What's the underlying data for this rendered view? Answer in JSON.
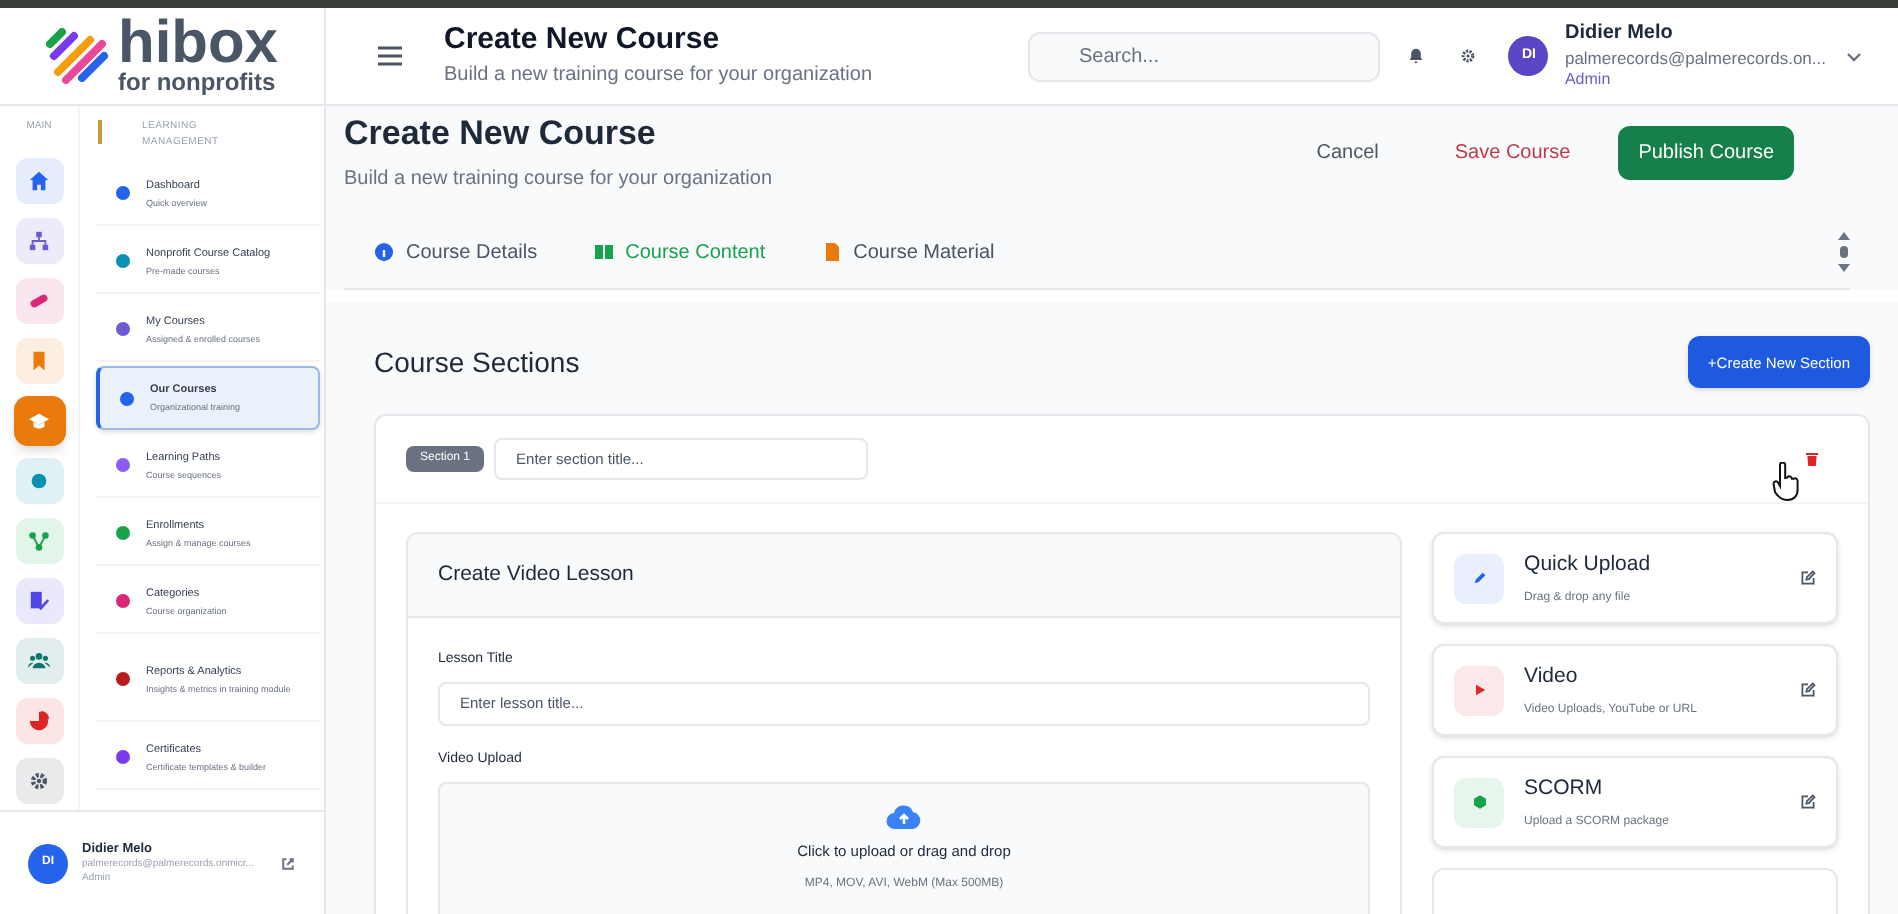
{
  "logo": {
    "name": "hibox",
    "tagline": "for nonprofits"
  },
  "header": {
    "title": "Create New Course",
    "subtitle": "Build a new training course for your organization",
    "search": {
      "placeholder": "Search..."
    },
    "user": {
      "initials": "DI",
      "name": "Didier Melo",
      "email": "palmerecords@palmerecords.on...",
      "role": "Admin"
    }
  },
  "rail": {
    "label": "MAIN",
    "items": [
      {
        "kind": "home",
        "color": "#2563eb",
        "selected": false
      },
      {
        "kind": "sitemap",
        "color": "#6d5bd0",
        "selected": false
      },
      {
        "kind": "pill",
        "color": "#db2777",
        "selected": false
      },
      {
        "kind": "bookmark",
        "color": "#ea7a0c",
        "selected": false
      },
      {
        "kind": "cap",
        "color": "#ea7a0c",
        "selected": true
      },
      {
        "kind": "dot",
        "color": "#0891b2",
        "selected": false
      },
      {
        "kind": "nodes",
        "color": "#16a34a",
        "selected": false
      },
      {
        "kind": "edit",
        "color": "#4f46e5",
        "selected": false
      },
      {
        "kind": "people",
        "color": "#0f766e",
        "selected": false
      },
      {
        "kind": "pie",
        "color": "#dc2626",
        "selected": false
      },
      {
        "kind": "gear",
        "color": "#4b5563",
        "selected": false
      }
    ]
  },
  "nav": {
    "label": "LEARNING MANAGEMENT",
    "items": [
      {
        "title": "Dashboard",
        "subtitle": "Quick overview",
        "color": "#2563eb",
        "selected": false
      },
      {
        "title": "Nonprofit Course Catalog",
        "subtitle": "Pre-made courses",
        "color": "#0891b2",
        "selected": false
      },
      {
        "title": "My Courses",
        "subtitle": "Assigned & enrolled courses",
        "color": "#6d5bd0",
        "selected": false
      },
      {
        "title": "Our Courses",
        "subtitle": "Organizational training",
        "color": "#2563eb",
        "selected": true
      },
      {
        "title": "Learning Paths",
        "subtitle": "Course sequences",
        "color": "#8b5cf6",
        "selected": false
      },
      {
        "title": "Enrollments",
        "subtitle": "Assign & manage courses",
        "color": "#16a34a",
        "selected": false
      },
      {
        "title": "Categories",
        "subtitle": "Course organization",
        "color": "#db2777",
        "selected": false
      },
      {
        "title": "Reports & Analytics",
        "subtitle": "Insights & metrics in training module",
        "color": "#b91c1c",
        "selected": false
      },
      {
        "title": "Certificates",
        "subtitle": "Certificate templates & builder",
        "color": "#7c3aed",
        "selected": false
      }
    ]
  },
  "sidebar_user": {
    "initials": "DI",
    "name": "Didier Melo",
    "email": "palmerecords@palmerecords.onmicr...",
    "role": "Admin"
  },
  "page": {
    "title": "Create New Course",
    "subtitle": "Build a new training course for your organization",
    "actions": [
      "Cancel",
      "Save Course",
      "Publish Course"
    ]
  },
  "tabs": [
    {
      "label": "Course Details",
      "selected": false,
      "color": "#2563eb"
    },
    {
      "label": "Course Content",
      "selected": true,
      "color": "#16a34a"
    },
    {
      "label": "Course Material",
      "selected": false,
      "color": "#ea7a0c"
    }
  ],
  "sections": {
    "title": "Course Sections",
    "create_button": "+Create New Section",
    "section_badge": "Section 1",
    "section_placeholder": "Enter section title..."
  },
  "lesson": {
    "title": "Create Video Lesson",
    "title_label": "Lesson Title",
    "title_placeholder": "Enter lesson title...",
    "upload_label": "Video Upload",
    "upload_text": "Click to upload or drag and drop",
    "upload_hint": "MP4, MOV, AVI, WebM (Max 500MB)"
  },
  "lesson_types": [
    {
      "kind": "quick",
      "title": "Quick Upload",
      "subtitle": "Drag & drop any file",
      "color": "#2563eb"
    },
    {
      "kind": "video",
      "title": "Video",
      "subtitle": "Video Uploads, YouTube or URL",
      "color": "#dc2626"
    },
    {
      "kind": "scorm",
      "title": "SCORM",
      "subtitle": "Upload a SCORM package",
      "color": "#16a34a"
    }
  ]
}
